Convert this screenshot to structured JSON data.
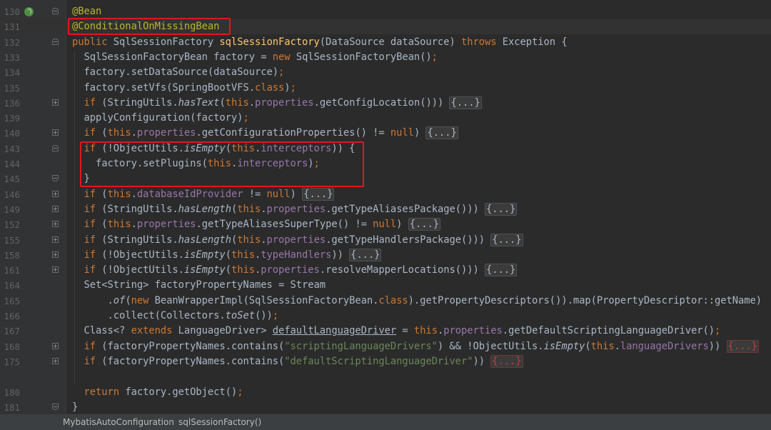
{
  "editor": {
    "lines": [
      {
        "num": "130",
        "tokens": [
          {
            "t": "@Bean",
            "c": "ann"
          }
        ]
      },
      {
        "num": "131",
        "tokens": [
          {
            "t": "@ConditionalOnMissingBean",
            "c": "ann"
          }
        ]
      },
      {
        "num": "132",
        "tokens": [
          {
            "t": "public ",
            "c": "kw"
          },
          {
            "t": "SqlSessionFactory "
          },
          {
            "t": "sqlSessionFactory",
            "c": "fn"
          },
          {
            "t": "(DataSource dataSource) "
          },
          {
            "t": "throws ",
            "c": "kw"
          },
          {
            "t": "Exception {"
          }
        ]
      },
      {
        "num": "133",
        "tokens": [
          {
            "t": "  SqlSessionFactoryBean factory = "
          },
          {
            "t": "new ",
            "c": "kw"
          },
          {
            "t": "SqlSessionFactoryBean()"
          },
          {
            "t": ";",
            "c": "kw"
          }
        ]
      },
      {
        "num": "134",
        "tokens": [
          {
            "t": "  factory.setDataSource(dataSource)"
          },
          {
            "t": ";",
            "c": "kw"
          }
        ]
      },
      {
        "num": "135",
        "tokens": [
          {
            "t": "  factory.setVfs(SpringBootVFS."
          },
          {
            "t": "class",
            "c": "kw"
          },
          {
            "t": ")"
          },
          {
            "t": ";",
            "c": "kw"
          }
        ]
      },
      {
        "num": "136",
        "tokens": [
          {
            "t": "  "
          },
          {
            "t": "if ",
            "c": "kw"
          },
          {
            "t": "(StringUtils."
          },
          {
            "t": "hasText",
            "c": "it"
          },
          {
            "t": "("
          },
          {
            "t": "this",
            "c": "kw"
          },
          {
            "t": "."
          },
          {
            "t": "properties",
            "c": "fld"
          },
          {
            "t": ".getConfigLocation())) "
          },
          {
            "t": "{...}",
            "c": "fold-box"
          }
        ]
      },
      {
        "num": "139",
        "tokens": [
          {
            "t": "  applyConfiguration(factory)"
          },
          {
            "t": ";",
            "c": "kw"
          }
        ]
      },
      {
        "num": "140",
        "tokens": [
          {
            "t": "  "
          },
          {
            "t": "if ",
            "c": "kw"
          },
          {
            "t": "("
          },
          {
            "t": "this",
            "c": "kw"
          },
          {
            "t": "."
          },
          {
            "t": "properties",
            "c": "fld"
          },
          {
            "t": ".getConfigurationProperties() != "
          },
          {
            "t": "null",
            "c": "kw"
          },
          {
            "t": ") "
          },
          {
            "t": "{...}",
            "c": "fold-box"
          }
        ]
      },
      {
        "num": "143",
        "tokens": [
          {
            "t": "  "
          },
          {
            "t": "if ",
            "c": "kw"
          },
          {
            "t": "(!ObjectUtils."
          },
          {
            "t": "isEmpty",
            "c": "it"
          },
          {
            "t": "("
          },
          {
            "t": "this",
            "c": "kw"
          },
          {
            "t": "."
          },
          {
            "t": "interceptors",
            "c": "fld"
          },
          {
            "t": ")) {"
          }
        ]
      },
      {
        "num": "144",
        "tokens": [
          {
            "t": "    factory.setPlugins("
          },
          {
            "t": "this",
            "c": "kw"
          },
          {
            "t": "."
          },
          {
            "t": "interceptors",
            "c": "fld"
          },
          {
            "t": ")"
          },
          {
            "t": ";",
            "c": "kw"
          }
        ]
      },
      {
        "num": "145",
        "tokens": [
          {
            "t": "  }"
          }
        ]
      },
      {
        "num": "146",
        "tokens": [
          {
            "t": "  "
          },
          {
            "t": "if ",
            "c": "kw"
          },
          {
            "t": "("
          },
          {
            "t": "this",
            "c": "kw"
          },
          {
            "t": "."
          },
          {
            "t": "databaseIdProvider",
            "c": "fld"
          },
          {
            "t": " != "
          },
          {
            "t": "null",
            "c": "kw"
          },
          {
            "t": ") "
          },
          {
            "t": "{...}",
            "c": "fold-box"
          }
        ]
      },
      {
        "num": "149",
        "tokens": [
          {
            "t": "  "
          },
          {
            "t": "if ",
            "c": "kw"
          },
          {
            "t": "(StringUtils."
          },
          {
            "t": "hasLength",
            "c": "it"
          },
          {
            "t": "("
          },
          {
            "t": "this",
            "c": "kw"
          },
          {
            "t": "."
          },
          {
            "t": "properties",
            "c": "fld"
          },
          {
            "t": ".getTypeAliasesPackage())) "
          },
          {
            "t": "{...}",
            "c": "fold-box"
          }
        ]
      },
      {
        "num": "152",
        "tokens": [
          {
            "t": "  "
          },
          {
            "t": "if ",
            "c": "kw"
          },
          {
            "t": "("
          },
          {
            "t": "this",
            "c": "kw"
          },
          {
            "t": "."
          },
          {
            "t": "properties",
            "c": "fld"
          },
          {
            "t": ".getTypeAliasesSuperType() != "
          },
          {
            "t": "null",
            "c": "kw"
          },
          {
            "t": ") "
          },
          {
            "t": "{...}",
            "c": "fold-box"
          }
        ]
      },
      {
        "num": "155",
        "tokens": [
          {
            "t": "  "
          },
          {
            "t": "if ",
            "c": "kw"
          },
          {
            "t": "(StringUtils."
          },
          {
            "t": "hasLength",
            "c": "it"
          },
          {
            "t": "("
          },
          {
            "t": "this",
            "c": "kw"
          },
          {
            "t": "."
          },
          {
            "t": "properties",
            "c": "fld"
          },
          {
            "t": ".getTypeHandlersPackage())) "
          },
          {
            "t": "{...}",
            "c": "fold-box"
          }
        ]
      },
      {
        "num": "158",
        "tokens": [
          {
            "t": "  "
          },
          {
            "t": "if ",
            "c": "kw"
          },
          {
            "t": "(!ObjectUtils."
          },
          {
            "t": "isEmpty",
            "c": "it"
          },
          {
            "t": "("
          },
          {
            "t": "this",
            "c": "kw"
          },
          {
            "t": "."
          },
          {
            "t": "typeHandlers",
            "c": "fld"
          },
          {
            "t": ")) "
          },
          {
            "t": "{...}",
            "c": "fold-box"
          }
        ]
      },
      {
        "num": "161",
        "tokens": [
          {
            "t": "  "
          },
          {
            "t": "if ",
            "c": "kw"
          },
          {
            "t": "(!ObjectUtils."
          },
          {
            "t": "isEmpty",
            "c": "it"
          },
          {
            "t": "("
          },
          {
            "t": "this",
            "c": "kw"
          },
          {
            "t": "."
          },
          {
            "t": "properties",
            "c": "fld"
          },
          {
            "t": ".resolveMapperLocations())) "
          },
          {
            "t": "{...}",
            "c": "fold-box"
          }
        ]
      },
      {
        "num": "164",
        "tokens": [
          {
            "t": "  Set<String> factoryPropertyNames = Stream"
          }
        ]
      },
      {
        "num": "165",
        "tokens": [
          {
            "t": "      ."
          },
          {
            "t": "of",
            "c": "it"
          },
          {
            "t": "("
          },
          {
            "t": "new ",
            "c": "kw"
          },
          {
            "t": "BeanWrapperImpl(SqlSessionFactoryBean."
          },
          {
            "t": "class",
            "c": "kw"
          },
          {
            "t": ").getPropertyDescriptors()).map(PropertyDescriptor::getName)"
          }
        ]
      },
      {
        "num": "166",
        "tokens": [
          {
            "t": "      .collect(Collectors."
          },
          {
            "t": "toSet",
            "c": "it"
          },
          {
            "t": "())"
          },
          {
            "t": ";",
            "c": "kw"
          }
        ]
      },
      {
        "num": "167",
        "tokens": [
          {
            "t": "  Class<? "
          },
          {
            "t": "extends ",
            "c": "kw"
          },
          {
            "t": "LanguageDriver> "
          },
          {
            "t": "defaultLanguageDriver",
            "c": "ul"
          },
          {
            "t": " = "
          },
          {
            "t": "this",
            "c": "kw"
          },
          {
            "t": "."
          },
          {
            "t": "properties",
            "c": "fld"
          },
          {
            "t": ".getDefaultScriptingLanguageDriver()"
          },
          {
            "t": ";",
            "c": "kw"
          }
        ]
      },
      {
        "num": "168",
        "tokens": [
          {
            "t": "  "
          },
          {
            "t": "if ",
            "c": "kw"
          },
          {
            "t": "(factoryPropertyNames.contains("
          },
          {
            "t": "\"scriptingLanguageDrivers\"",
            "c": "str"
          },
          {
            "t": ") && !ObjectUtils."
          },
          {
            "t": "isEmpty",
            "c": "it"
          },
          {
            "t": "("
          },
          {
            "t": "this",
            "c": "kw"
          },
          {
            "t": "."
          },
          {
            "t": "languageDrivers",
            "c": "fld"
          },
          {
            "t": ")) "
          },
          {
            "t": "{...}",
            "c": "fold-box err"
          }
        ]
      },
      {
        "num": "175",
        "tokens": [
          {
            "t": "  "
          },
          {
            "t": "if ",
            "c": "kw"
          },
          {
            "t": "(factoryPropertyNames.contains("
          },
          {
            "t": "\"defaultScriptingLanguageDriver\"",
            "c": "str"
          },
          {
            "t": ")) "
          },
          {
            "t": "{...}",
            "c": "fold-box err"
          }
        ]
      },
      {
        "num": "",
        "tokens": []
      },
      {
        "num": "180",
        "tokens": [
          {
            "t": "  "
          },
          {
            "t": "return ",
            "c": "kw"
          },
          {
            "t": "factory.getObject()"
          },
          {
            "t": ";",
            "c": "kw"
          }
        ]
      },
      {
        "num": "181",
        "tokens": [
          {
            "t": "}"
          }
        ]
      }
    ]
  },
  "status": {
    "breadcrumb": [
      "MybatisAutoConfiguration",
      "sqlSessionFactory()"
    ]
  },
  "colors": {
    "background": "#2b2b2b",
    "gutter": "#313335",
    "keyword": "#cc7832",
    "annotation": "#bbb529",
    "method_decl": "#ffc66d",
    "field": "#9876aa",
    "string": "#6a8759",
    "highlight_box": "#e0171d"
  }
}
